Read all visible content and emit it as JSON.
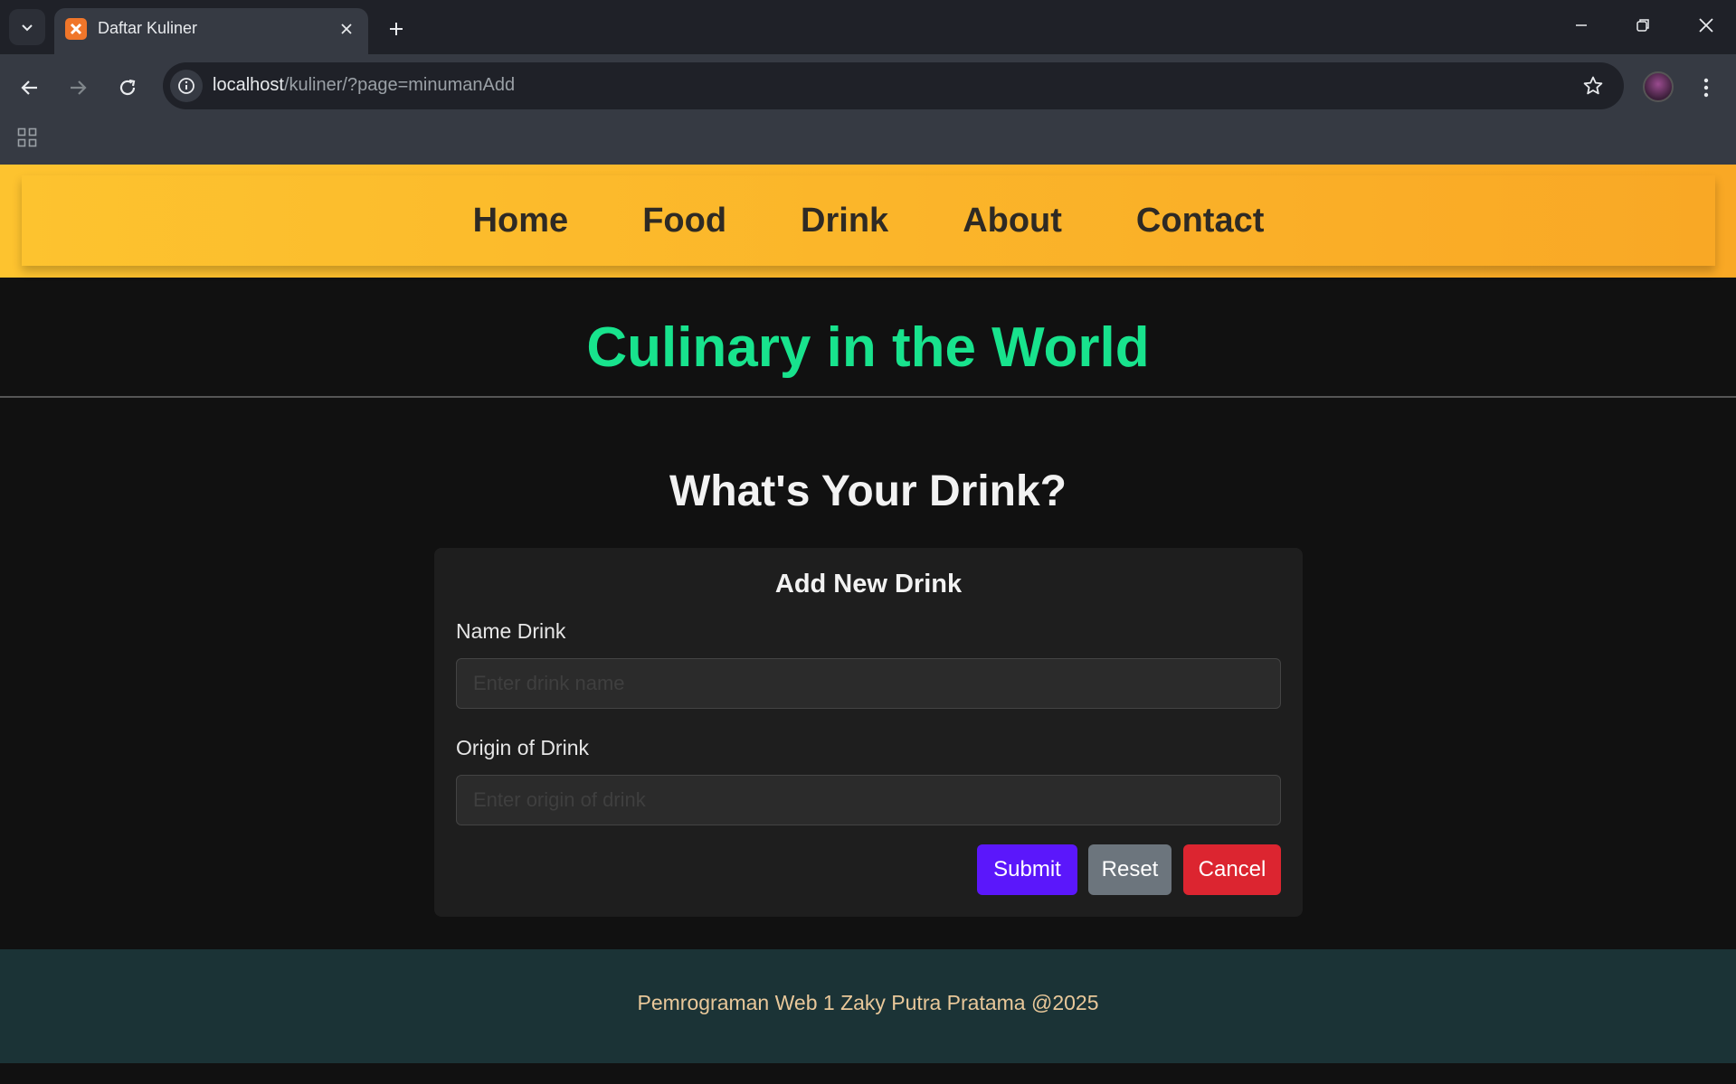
{
  "browser": {
    "tab_title": "Daftar Kuliner",
    "url_host": "localhost",
    "url_path": "/kuliner/?page=minumanAdd"
  },
  "nav": {
    "items": [
      "Home",
      "Food",
      "Drink",
      "About",
      "Contact"
    ]
  },
  "site_title": "Culinary in the World",
  "section_title": "What's Your Drink?",
  "form": {
    "title": "Add New Drink",
    "name_label": "Name Drink",
    "name_placeholder": "Enter drink name",
    "name_value": "",
    "origin_label": "Origin of Drink",
    "origin_placeholder": "Enter origin of drink",
    "origin_value": "",
    "submit_label": "Submit",
    "reset_label": "Reset",
    "cancel_label": "Cancel"
  },
  "footer": {
    "text": "Pemrograman Web 1 Zaky Putra Pratama @2025"
  },
  "colors": {
    "nav_bg_start": "#fdc32f",
    "nav_bg_end": "#f9a825",
    "site_title": "#18e38d",
    "submit": "#5b17fb",
    "reset": "#6c757d",
    "cancel": "#dc2530",
    "footer_bg": "#1b3336",
    "footer_text": "#e9c89a"
  }
}
